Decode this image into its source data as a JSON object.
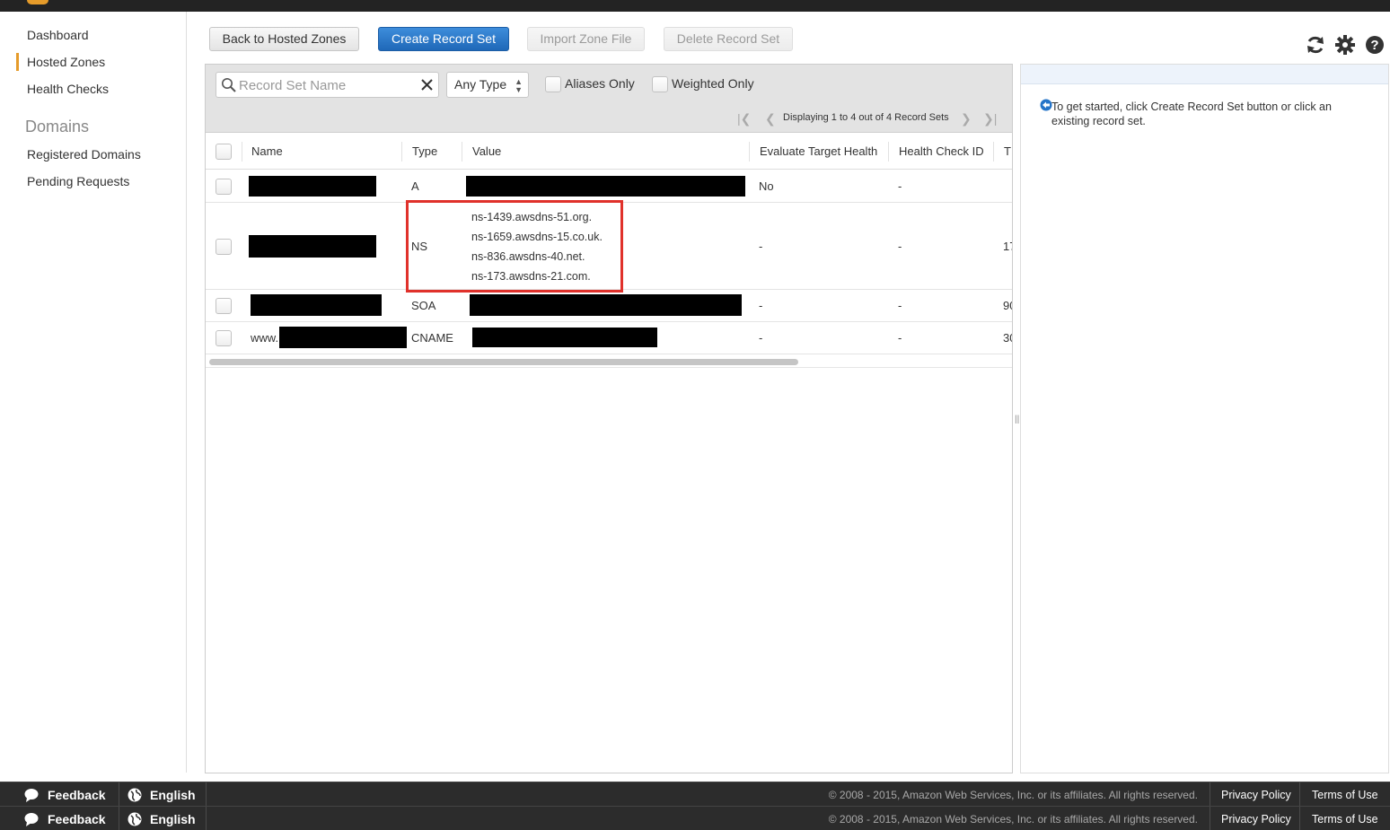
{
  "sidebar": {
    "items": [
      {
        "label": "Dashboard"
      },
      {
        "label": "Hosted Zones",
        "active": true
      },
      {
        "label": "Health Checks"
      }
    ],
    "heading": "Domains",
    "domain_items": [
      {
        "label": "Registered Domains"
      },
      {
        "label": "Pending Requests"
      }
    ]
  },
  "toolbar": {
    "back_label": "Back to Hosted Zones",
    "create_label": "Create Record Set",
    "import_label": "Import Zone File",
    "delete_label": "Delete Record Set",
    "icons": [
      "refresh-icon",
      "gear-icon",
      "help-icon"
    ]
  },
  "filters": {
    "search_placeholder": "Record Set Name",
    "type_value": "Any Type",
    "aliases_label": "Aliases Only",
    "weighted_label": "Weighted Only",
    "pager_text": "Displaying 1 to 4 out of 4 Record Sets"
  },
  "table": {
    "columns": [
      "Name",
      "Type",
      "Value",
      "Evaluate Target Health",
      "Health Check ID",
      "T"
    ],
    "rows": [
      {
        "type": "A",
        "eval": "No",
        "health": "-",
        "ttl": ""
      },
      {
        "type": "NS",
        "eval": "-",
        "health": "-",
        "ttl": "17",
        "values": [
          "ns-1439.awsdns-51.org.",
          "ns-1659.awsdns-15.co.uk.",
          "ns-836.awsdns-40.net.",
          "ns-173.awsdns-21.com."
        ]
      },
      {
        "type": "SOA",
        "eval": "-",
        "health": "-",
        "ttl": "90"
      },
      {
        "type": "CNAME",
        "name_prefix": "www.",
        "eval": "-",
        "health": "-",
        "ttl": "30"
      }
    ]
  },
  "right_panel": {
    "message": "To get started, click Create Record Set button or click an existing record set."
  },
  "footer": {
    "feedback": "Feedback",
    "language": "English",
    "copyright": "© 2008 - 2015, Amazon Web Services, Inc. or its affiliates. All rights reserved.",
    "privacy": "Privacy Policy",
    "terms": "Terms of Use"
  },
  "colors": {
    "accent": "#e59b2a",
    "primary_button": "#2574c8",
    "highlight_box": "#e0312b"
  }
}
